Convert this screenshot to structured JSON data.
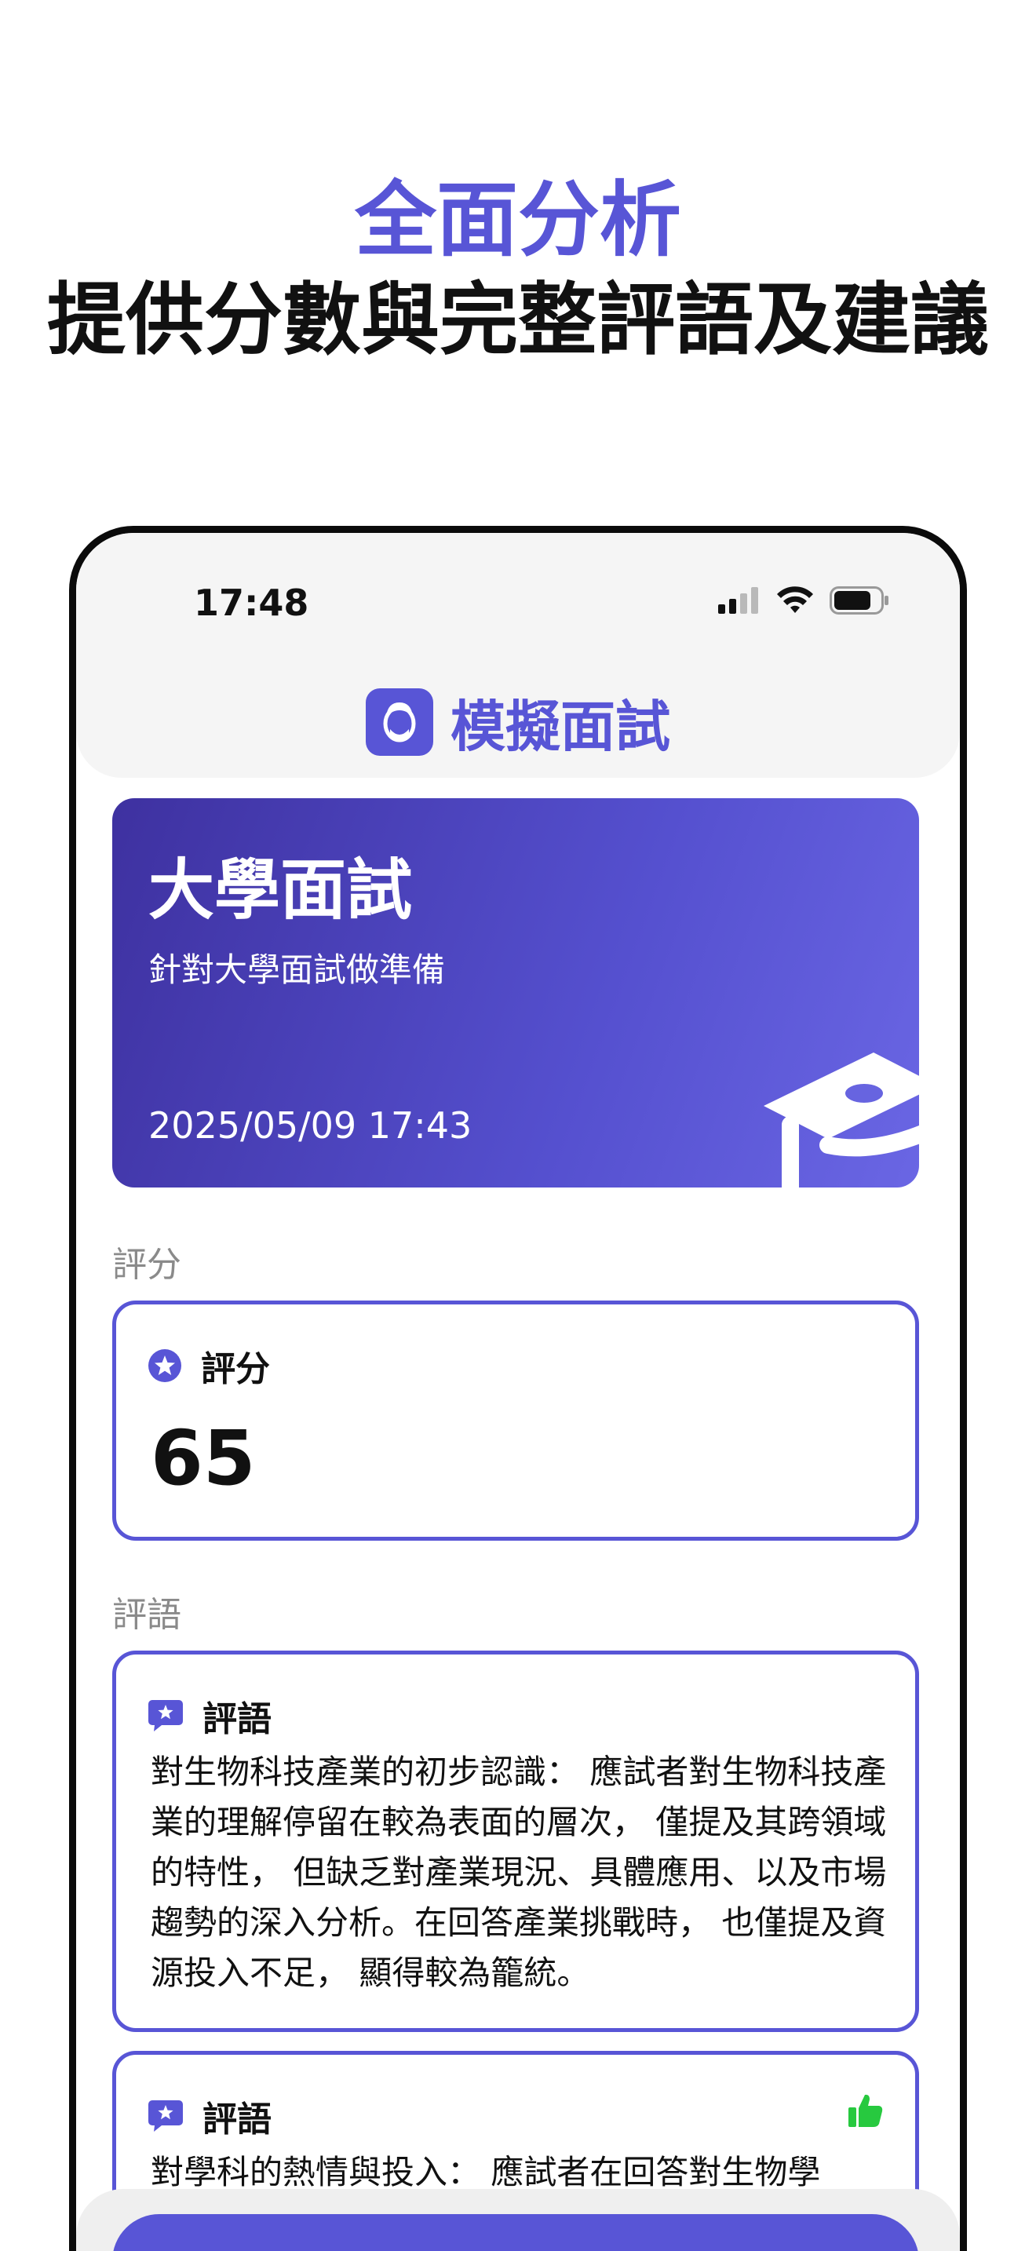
{
  "promo": {
    "subtitle": "全面分析",
    "title": "提供分數與完整評語及建議"
  },
  "status_bar": {
    "time": "17:48"
  },
  "app": {
    "title": "模擬面試",
    "logo_icon": "interviewer-face-icon"
  },
  "hero": {
    "title": "大學面試",
    "description": "針對大學面試做準備",
    "date": "2025/05/09 17:43",
    "icon": "graduation-cap-icon"
  },
  "score_section": {
    "label": "評分",
    "card_label": "評分",
    "value": "65"
  },
  "comment_section": {
    "label": "評語",
    "cards": [
      {
        "label": "評語",
        "text": "對生物科技產業的初步認識： 應試者對生物科技產業的理解停留在較為表面的層次， 僅提及其跨領域的特性， 但缺乏對產業現況、具體應用、以及市場趨勢的深入分析。在回答產業挑戰時， 也僅提及資源投入不足， 顯得較為籠統。"
      },
      {
        "label": "評語",
        "text": "對學科的熱情與投入： 應試者在回答對生物學"
      }
    ]
  },
  "colors": {
    "accent": "#5855d6",
    "hero_gradient_start": "#3e31a0",
    "hero_gradient_end": "#6a66e4",
    "thumb_green": "#27c93f"
  }
}
